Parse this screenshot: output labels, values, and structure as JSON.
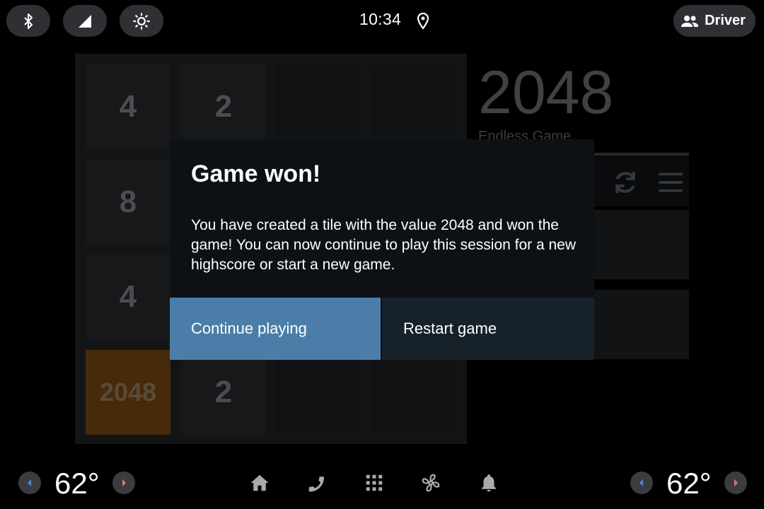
{
  "status_bar": {
    "time": "10:34",
    "driver_label": "Driver"
  },
  "game": {
    "logo": "2048",
    "subtitle": "Endless Game",
    "tiles": [
      "4",
      "2",
      "",
      "",
      "8",
      "",
      "",
      "",
      "4",
      "",
      "",
      "",
      "2048",
      "2",
      "",
      ""
    ]
  },
  "dialog": {
    "title": "Game won!",
    "message": "You have created a tile with the value 2048 and won the game! You can now continue to play this session for a new highscore or start a new game.",
    "continue_label": "Continue playing",
    "restart_label": "Restart game"
  },
  "climate": {
    "left_temp": "62°",
    "right_temp": "62°"
  },
  "colors": {
    "primary_button": "#4a7ea8",
    "secondary_button": "#172129",
    "dialog_bg": "#0d1116",
    "tile_2048": "#462a0a"
  },
  "icons": [
    "bluetooth-icon",
    "signal-icon",
    "brightness-icon",
    "location-icon",
    "people-icon",
    "refresh-icon",
    "menu-icon",
    "home-icon",
    "phone-icon",
    "apps-grid-icon",
    "fan-icon",
    "bell-icon",
    "chevron-left-icon",
    "chevron-right-icon"
  ]
}
